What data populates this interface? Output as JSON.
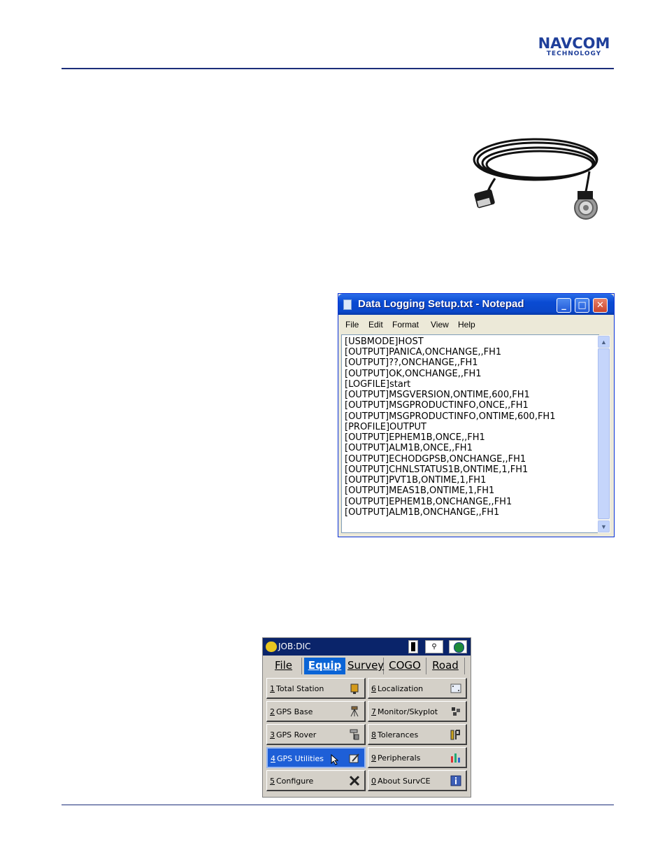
{
  "header": {
    "logo_line1": "NAVCOM",
    "logo_line2": "TECHNOLOGY"
  },
  "notepad": {
    "title": "Data Logging Setup.txt - Notepad",
    "menu": [
      "File",
      "Edit",
      "Format",
      "View",
      "Help"
    ],
    "lines": [
      "[USBMODE]HOST",
      "[OUTPUT]PANICA,ONCHANGE,,FH1",
      "[OUTPUT]??,ONCHANGE,,FH1",
      "[OUTPUT]OK,ONCHANGE,,FH1",
      "[LOGFILE]start",
      "[OUTPUT]MSGVERSION,ONTIME,600,FH1",
      "[OUTPUT]MSGPRODUCTINFO,ONCE,,FH1",
      "[OUTPUT]MSGPRODUCTINFO,ONTIME,600,FH1",
      "[PROFILE]OUTPUT",
      "[OUTPUT]EPHEM1B,ONCE,,FH1",
      "[OUTPUT]ALM1B,ONCE,,FH1",
      "[OUTPUT]ECHODGPSB,ONCHANGE,,FH1",
      "[OUTPUT]CHNLSTATUS1B,ONTIME,1,FH1",
      "[OUTPUT]PVT1B,ONTIME,1,FH1",
      "[OUTPUT]MEAS1B,ONTIME,1,FH1",
      "[OUTPUT]EPHEM1B,ONCHANGE,,FH1",
      "[OUTPUT]ALM1B,ONCHANGE,,FH1"
    ]
  },
  "survce": {
    "title": "JOB:DIC",
    "tabs": [
      "File",
      "Equip",
      "Survey",
      "COGO",
      "Road"
    ],
    "selected_tab": "Equip",
    "buttons": [
      {
        "num": "1",
        "label": "Total Station"
      },
      {
        "num": "6",
        "label": "Localization"
      },
      {
        "num": "2",
        "label": "GPS Base"
      },
      {
        "num": "7",
        "label": "Monitor/Skyplot"
      },
      {
        "num": "3",
        "label": "GPS Rover"
      },
      {
        "num": "8",
        "label": "Tolerances"
      },
      {
        "num": "4",
        "label": "GPS Utilities"
      },
      {
        "num": "9",
        "label": "Peripherals"
      },
      {
        "num": "5",
        "label": "Configure"
      },
      {
        "num": "0",
        "label": "About SurvCE"
      }
    ],
    "selected_button": "GPS Utilities"
  },
  "colors": {
    "brand": "#1f3f9a",
    "xp_title": "#0a4bd3",
    "survce_title": "#0a246a",
    "selection": "#1e5fd7"
  }
}
